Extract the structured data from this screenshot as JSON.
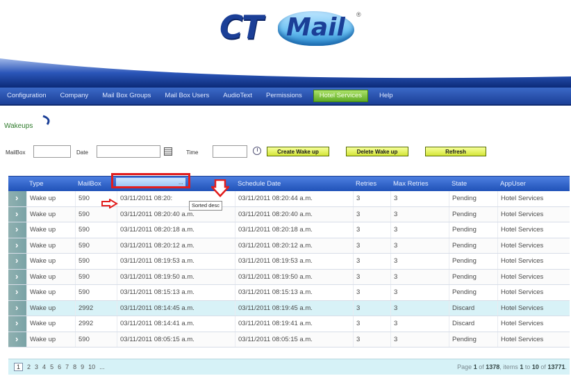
{
  "logo": {
    "part1": "CT",
    "part2": "Mail",
    "reg": "®"
  },
  "nav": [
    {
      "label": "Configuration",
      "active": false
    },
    {
      "label": "Company",
      "active": false
    },
    {
      "label": "Mail Box Groups",
      "active": false
    },
    {
      "label": "Mail Box Users",
      "active": false
    },
    {
      "label": "AudioText",
      "active": false
    },
    {
      "label": "Permissions",
      "active": false
    },
    {
      "label": "Hotel Services",
      "active": true
    },
    {
      "label": "Help",
      "active": false
    }
  ],
  "page": {
    "title": "Wakeups"
  },
  "filters": {
    "mailbox_label": "MailBox",
    "date_label": "Date",
    "time_label": "Time",
    "mailbox_value": "",
    "date_value": "",
    "time_value": "",
    "create_button": "Create Wake up",
    "delete_button": "Delete Wake up",
    "refresh_button": "Refresh"
  },
  "grid": {
    "columns": [
      "",
      "Type",
      "MailBox",
      "",
      "Schedule Date",
      "Retries",
      "Max Retries",
      "State",
      "AppUser"
    ],
    "sort_column_hint": "...",
    "sort_tooltip": "Sorted desc",
    "rows": [
      [
        "Wake up",
        "590",
        "03/11/2011 08:20:",
        "03/11/2011 08:20:44 a.m.",
        "3",
        "3",
        "Pending",
        "Hotel Services"
      ],
      [
        "Wake up",
        "590",
        "03/11/2011 08:20:40 a.m.",
        "03/11/2011 08:20:40 a.m.",
        "3",
        "3",
        "Pending",
        "Hotel Services"
      ],
      [
        "Wake up",
        "590",
        "03/11/2011 08:20:18 a.m.",
        "03/11/2011 08:20:18 a.m.",
        "3",
        "3",
        "Pending",
        "Hotel Services"
      ],
      [
        "Wake up",
        "590",
        "03/11/2011 08:20:12 a.m.",
        "03/11/2011 08:20:12 a.m.",
        "3",
        "3",
        "Pending",
        "Hotel Services"
      ],
      [
        "Wake up",
        "590",
        "03/11/2011 08:19:53 a.m.",
        "03/11/2011 08:19:53 a.m.",
        "3",
        "3",
        "Pending",
        "Hotel Services"
      ],
      [
        "Wake up",
        "590",
        "03/11/2011 08:19:50 a.m.",
        "03/11/2011 08:19:50 a.m.",
        "3",
        "3",
        "Pending",
        "Hotel Services"
      ],
      [
        "Wake up",
        "590",
        "03/11/2011 08:15:13 a.m.",
        "03/11/2011 08:15:13 a.m.",
        "3",
        "3",
        "Pending",
        "Hotel Services"
      ],
      [
        "Wake up",
        "2992",
        "03/11/2011 08:14:45 a.m.",
        "03/11/2011 08:19:45 a.m.",
        "3",
        "3",
        "Discard",
        "Hotel Services"
      ],
      [
        "Wake up",
        "2992",
        "03/11/2011 08:14:41 a.m.",
        "03/11/2011 08:19:41 a.m.",
        "3",
        "3",
        "Discard",
        "Hotel Services"
      ],
      [
        "Wake up",
        "590",
        "03/11/2011 08:05:15 a.m.",
        "03/11/2011 08:05:15 a.m.",
        "3",
        "3",
        "Pending",
        "Hotel Services"
      ]
    ],
    "highlighted_row": 7
  },
  "pager": {
    "pages": [
      "1",
      "2",
      "3",
      "4",
      "5",
      "6",
      "7",
      "8",
      "9",
      "10",
      "..."
    ],
    "current": "1",
    "info_prefix": "Page",
    "page": "1",
    "of_label": "of",
    "total_pages": "1378",
    "items_label": ", items",
    "from": "1",
    "to_label": "to",
    "to": "10",
    "total_items": "13771",
    "end": "."
  },
  "colors": {
    "nav_bg": "#1b3f97",
    "header_bg": "#2052b8",
    "active_tab": "#5eaa24",
    "highlight_row": "#d8f2f7",
    "annotation_red": "#e21d1d"
  }
}
